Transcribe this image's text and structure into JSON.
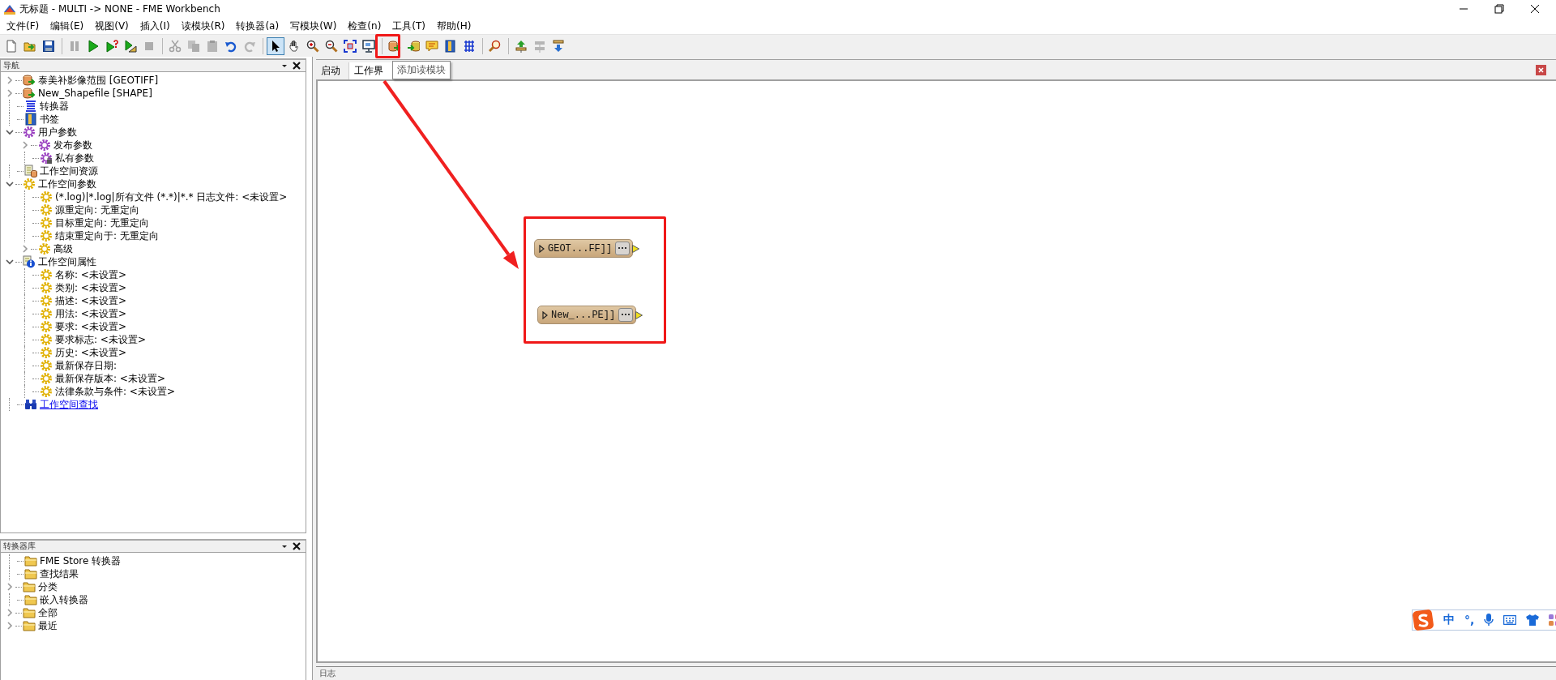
{
  "window": {
    "title": "无标题 - MULTI -> NONE - FME Workbench"
  },
  "menu": [
    "文件(F)",
    "编辑(E)",
    "视图(V)",
    "插入(I)",
    "读模块(R)",
    "转换器(a)",
    "写模块(W)",
    "检查(n)",
    "工具(T)",
    "帮助(H)"
  ],
  "toolbar": [
    {
      "kind": "new",
      "disabled": false,
      "pressed": false
    },
    {
      "kind": "open",
      "disabled": false,
      "pressed": false
    },
    {
      "kind": "save",
      "disabled": false,
      "pressed": false
    },
    {
      "kind": "separator"
    },
    {
      "kind": "pause",
      "disabled": true,
      "pressed": false
    },
    {
      "kind": "run",
      "disabled": false,
      "pressed": false
    },
    {
      "kind": "run-prompt",
      "disabled": false,
      "pressed": false
    },
    {
      "kind": "run-partial",
      "disabled": false,
      "pressed": false
    },
    {
      "kind": "stop",
      "disabled": true,
      "pressed": false
    },
    {
      "kind": "separator"
    },
    {
      "kind": "cut",
      "disabled": true,
      "pressed": false
    },
    {
      "kind": "copy",
      "disabled": true,
      "pressed": false
    },
    {
      "kind": "paste",
      "disabled": true,
      "pressed": false
    },
    {
      "kind": "undo",
      "disabled": false,
      "pressed": false
    },
    {
      "kind": "redo",
      "disabled": true,
      "pressed": false
    },
    {
      "kind": "separator"
    },
    {
      "kind": "select",
      "disabled": false,
      "pressed": true
    },
    {
      "kind": "pan",
      "disabled": false,
      "pressed": false
    },
    {
      "kind": "zoom-in",
      "disabled": false,
      "pressed": false
    },
    {
      "kind": "zoom-out",
      "disabled": false,
      "pressed": false
    },
    {
      "kind": "zoom-fit",
      "disabled": false,
      "pressed": false
    },
    {
      "kind": "zoom-window",
      "disabled": false,
      "pressed": false
    },
    {
      "kind": "separator"
    },
    {
      "kind": "add-reader",
      "disabled": false,
      "pressed": false
    },
    {
      "kind": "add-writer",
      "disabled": false,
      "pressed": false
    },
    {
      "kind": "annotation",
      "disabled": false,
      "pressed": false
    },
    {
      "kind": "bookmark",
      "disabled": false,
      "pressed": false
    },
    {
      "kind": "transformer",
      "disabled": false,
      "pressed": false
    },
    {
      "kind": "separator"
    },
    {
      "kind": "inspect",
      "disabled": false,
      "pressed": false
    },
    {
      "kind": "separator"
    },
    {
      "kind": "upload",
      "disabled": false,
      "pressed": false
    },
    {
      "kind": "connect",
      "disabled": true,
      "pressed": false
    },
    {
      "kind": "download",
      "disabled": false,
      "pressed": false
    }
  ],
  "navigator": {
    "title": "导航",
    "tree": [
      {
        "label": "泰美补影像范围 [GEOTIFF]",
        "kind": "reader",
        "expanded": false
      },
      {
        "label": "New_Shapefile [SHAPE]",
        "kind": "reader",
        "expanded": false
      },
      {
        "label": "转换器",
        "kind": "transformers"
      },
      {
        "label": "书签",
        "kind": "bookmarks"
      },
      {
        "label": "用户参数",
        "kind": "user-parameters",
        "expanded": true,
        "children": [
          {
            "label": "发布参数",
            "kind": "user-parameters",
            "expanded": false
          },
          {
            "label": "私有参数",
            "kind": "private-parameters"
          }
        ]
      },
      {
        "label": "工作空间资源",
        "kind": "resources"
      },
      {
        "label": "工作空间参数",
        "kind": "parameter",
        "expanded": true,
        "children": [
          {
            "label": "(*.log)|*.log|所有文件 (*.*)|*.* 日志文件: <未设置>",
            "kind": "parameter"
          },
          {
            "label": "源重定向: 无重定向",
            "kind": "parameter"
          },
          {
            "label": "目标重定向: 无重定向",
            "kind": "parameter"
          },
          {
            "label": "结束重定向于: 无重定向",
            "kind": "parameter"
          },
          {
            "label": "高级",
            "kind": "parameter",
            "expanded": false
          }
        ]
      },
      {
        "label": "工作空间属性",
        "kind": "properties",
        "expanded": true,
        "children": [
          {
            "label": "名称: <未设置>",
            "kind": "parameter"
          },
          {
            "label": "类别: <未设置>",
            "kind": "parameter"
          },
          {
            "label": "描述: <未设置>",
            "kind": "parameter"
          },
          {
            "label": "用法: <未设置>",
            "kind": "parameter"
          },
          {
            "label": "要求: <未设置>",
            "kind": "parameter"
          },
          {
            "label": "要求标志: <未设置>",
            "kind": "parameter"
          },
          {
            "label": "历史: <未设置>",
            "kind": "parameter"
          },
          {
            "label": "最新保存日期:",
            "kind": "parameter"
          },
          {
            "label": "最新保存版本: <未设置>",
            "kind": "parameter"
          },
          {
            "label": "法律条款与条件: <未设置>",
            "kind": "parameter"
          }
        ]
      },
      {
        "label": "工作空间查找",
        "kind": "link"
      }
    ]
  },
  "transformer_gallery": {
    "title": "转换器库",
    "tree": [
      {
        "label": "FME Store 转换器",
        "kind": "folder"
      },
      {
        "label": "查找结果",
        "kind": "folder"
      },
      {
        "label": "分类",
        "kind": "folder",
        "expanded": false
      },
      {
        "label": "嵌入转换器",
        "kind": "folder"
      },
      {
        "label": "全部",
        "kind": "folder",
        "expanded": false
      },
      {
        "label": "最近",
        "kind": "folder",
        "expanded": false
      }
    ]
  },
  "canvas_tabs": [
    {
      "label": "启动",
      "selected": false
    },
    {
      "label": "工作界",
      "selected": true
    }
  ],
  "tooltip": "添加读模块",
  "canvas": {
    "nodes": [
      {
        "label": "GEOT...FF]]"
      },
      {
        "label": "New_...PE]]"
      }
    ]
  },
  "log_panel": {
    "title": "日志"
  },
  "ime_toolbar": {
    "items": [
      "中",
      "°,"
    ]
  }
}
